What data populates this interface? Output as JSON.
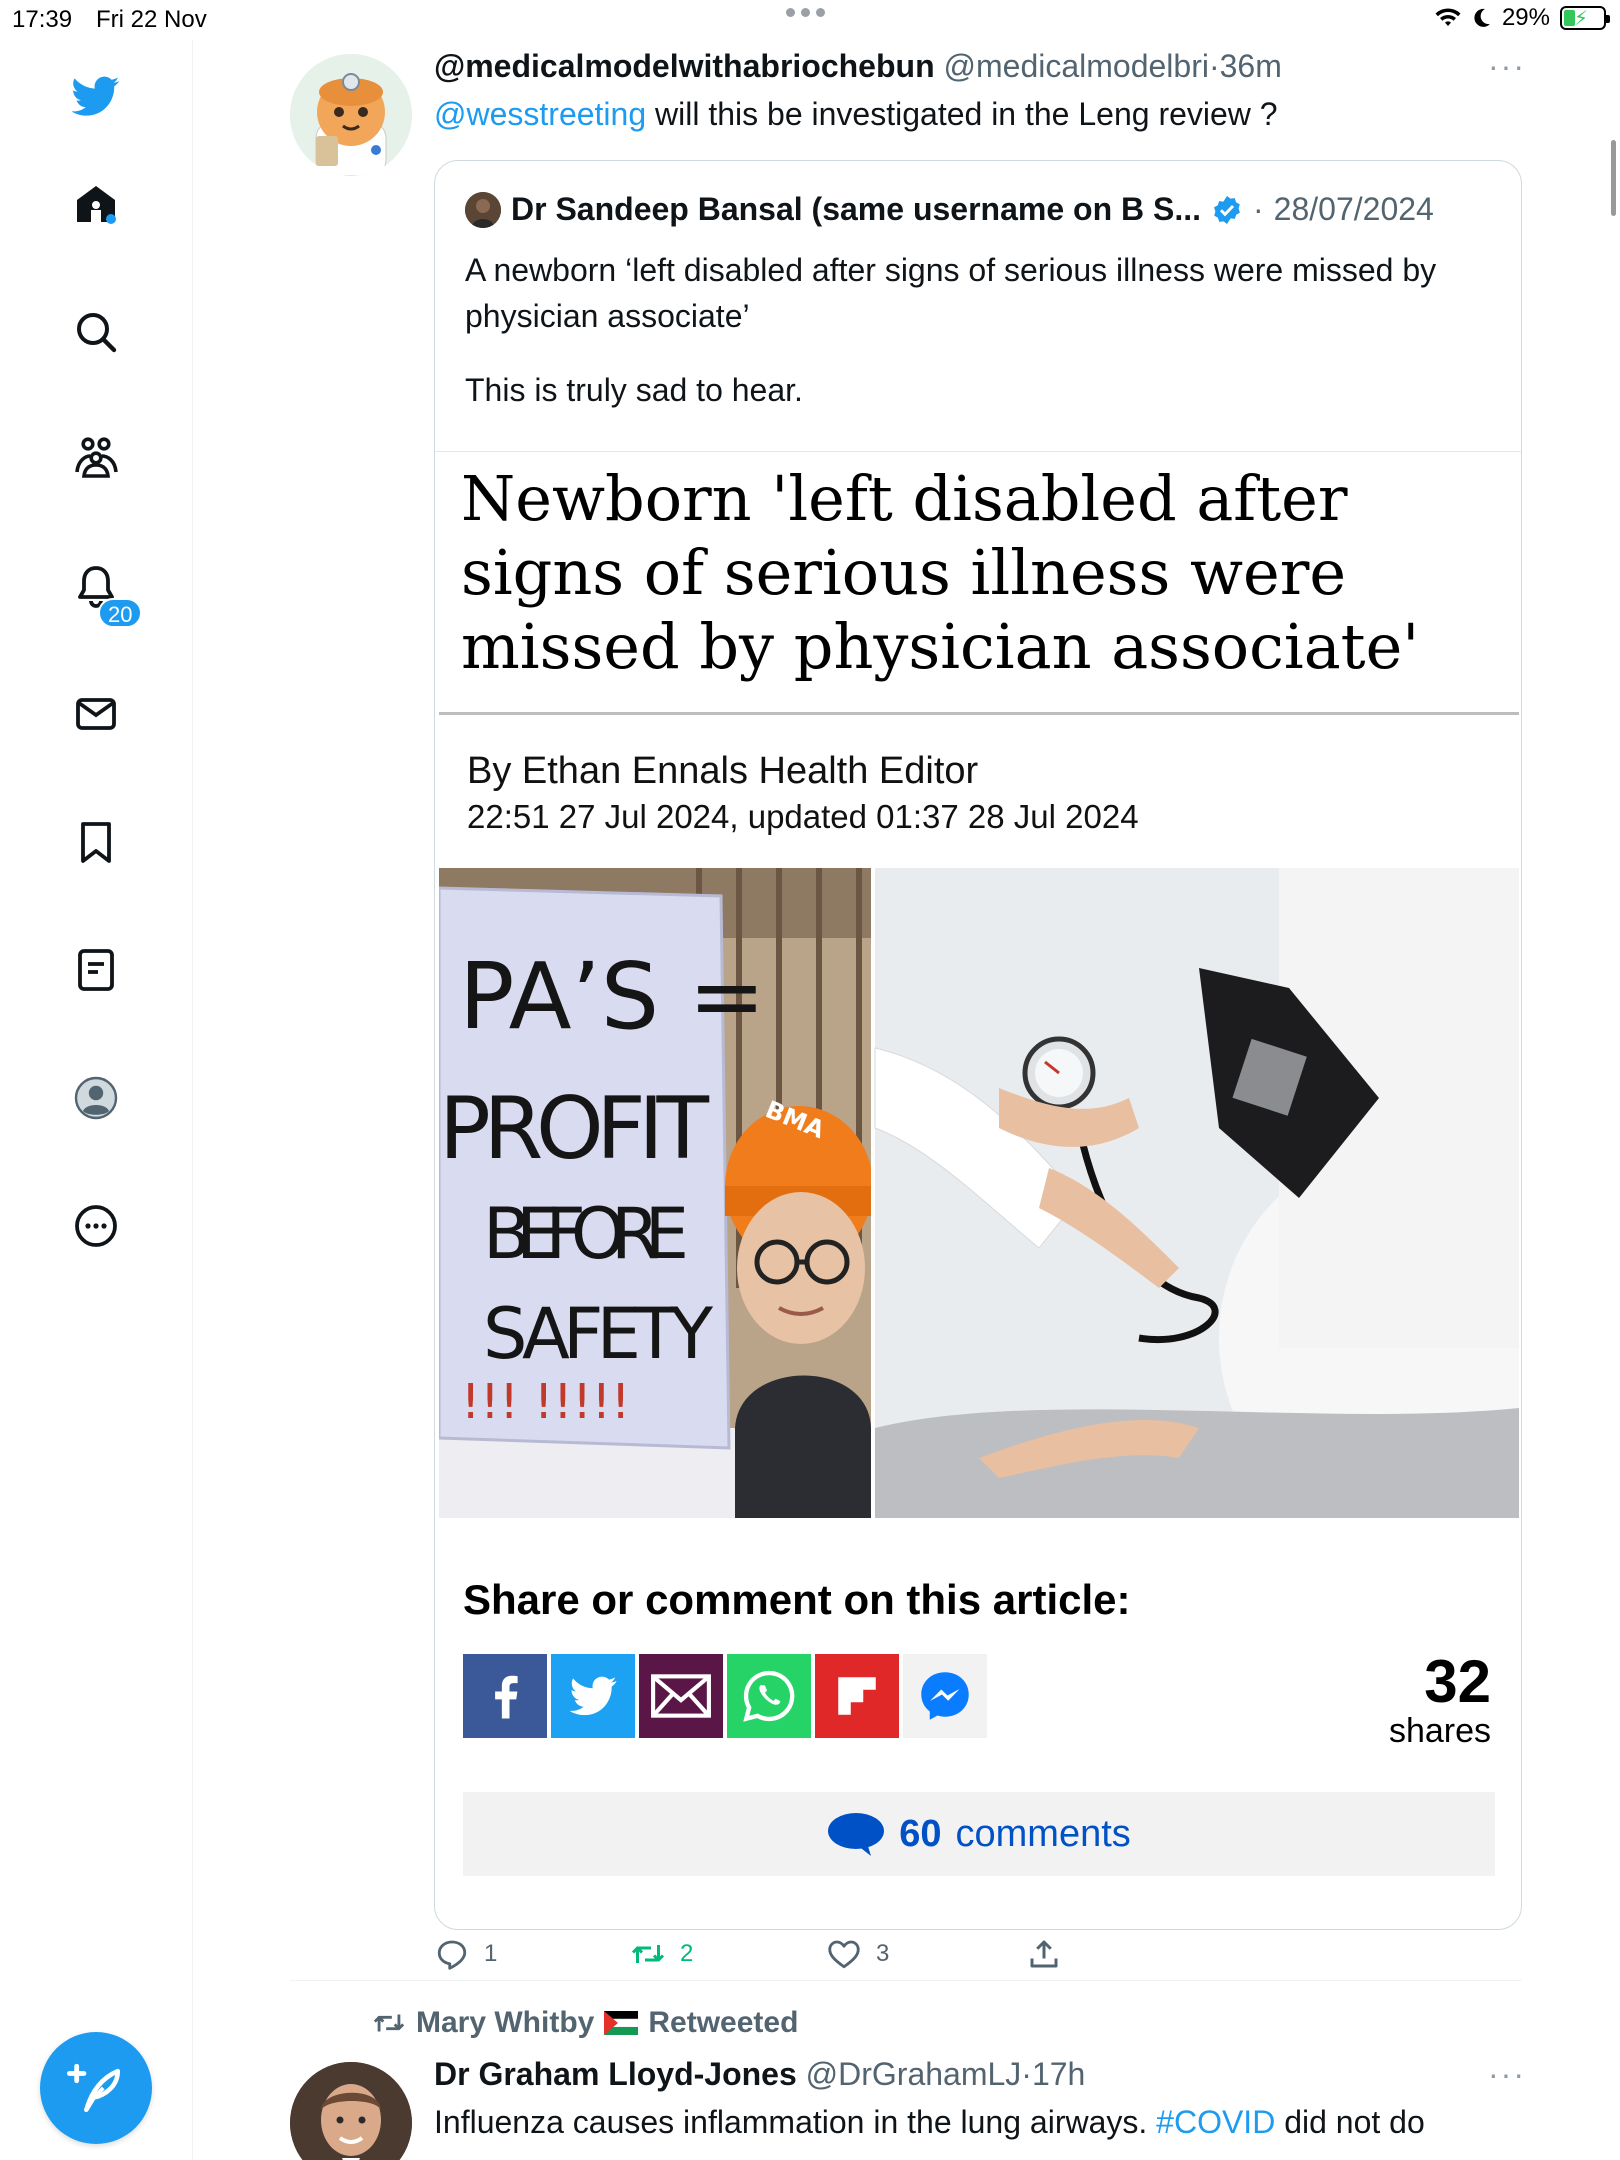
{
  "status_bar": {
    "time": "17:39",
    "date": "Fri 22 Nov",
    "battery": "29%"
  },
  "sidebar": {
    "notifications_badge": "20",
    "items": [
      "home-icon",
      "search-icon",
      "communities-icon",
      "bell-icon",
      "mail-icon",
      "bookmark-icon",
      "lists-icon",
      "profile-icon",
      "more-icon"
    ],
    "accent": "#1d9bf0"
  },
  "tweet1": {
    "name": "@medicalmodelwithabriochebun",
    "handle": "@medicalmodelbri",
    "sep": "·",
    "time": "36m",
    "more": "···",
    "mention": "@wesstreeting",
    "text": " will this be investigated in the Leng review ?",
    "quote": {
      "name": "Dr Sandeep Bansal (same username on B S...",
      "sep": "·",
      "date": "28/07/2024",
      "text_1": "A newborn ‘left disabled after signs of serious illness were missed by physician associate’",
      "text_2": "This is truly sad to hear.",
      "article": {
        "headline": "Newborn 'left disabled after signs of serious illness were missed by physician associate'",
        "byline": "By Ethan Ennals Health Editor",
        "date": "22:51 27 Jul 2024, updated 01:37 28 Jul 2024",
        "sign_line_1": "PA’S =",
        "sign_line_2": "PROFIT",
        "sign_line_3": "BEFORE",
        "sign_line_4": "SAFETY",
        "sign_line_5": "!!! !!!!!",
        "hat_text": "BMA",
        "share_title": "Share or comment on this article:",
        "share_count": "32",
        "share_label": "shares",
        "comments_count": "60",
        "comments_label": "comments"
      }
    },
    "actions": {
      "replies": "1",
      "retweets": "2",
      "likes": "3"
    }
  },
  "tweet2": {
    "retweeted_by": "Mary Whitby",
    "retweeted_label": "Retweeted",
    "name": "Dr Graham Lloyd-Jones",
    "handle": "@DrGrahamLJ",
    "sep": "·",
    "time": "17h",
    "more": "···",
    "text_before": "Influenza causes inflammation in the lung airways. ",
    "hashtag": "#COVID",
    "text_after": " did not do"
  }
}
